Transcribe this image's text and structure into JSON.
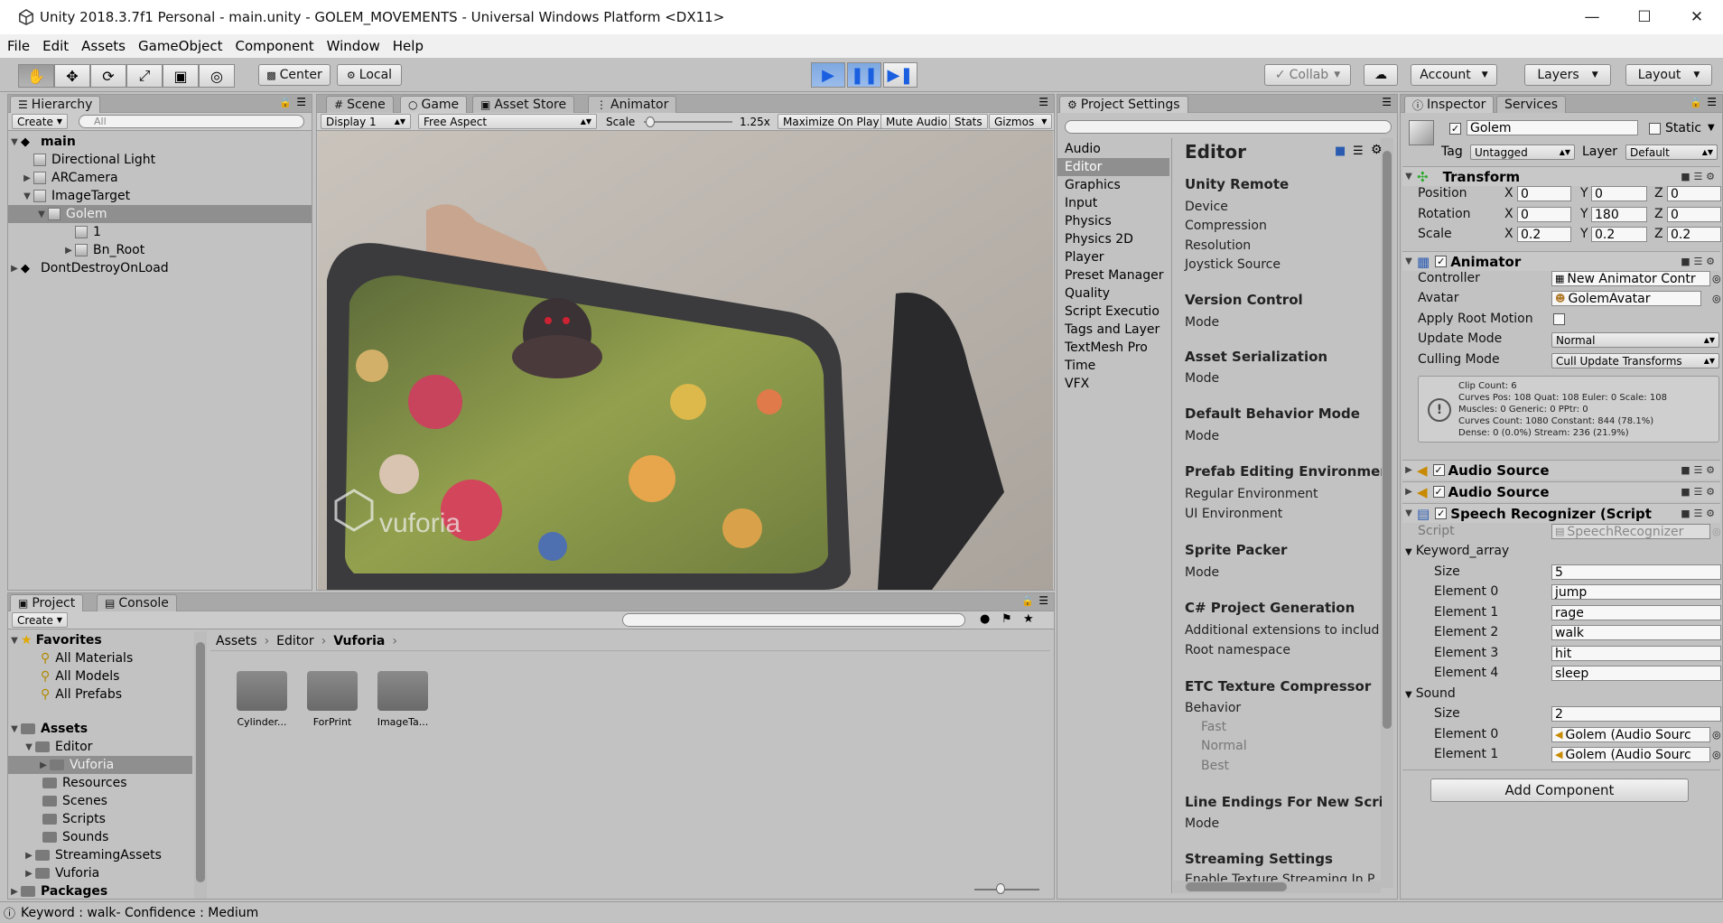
{
  "window": {
    "title": "Unity 2018.3.7f1 Personal - main.unity - GOLEM_MOVEMENTS - Universal Windows Platform <DX11>"
  },
  "menu": [
    "File",
    "Edit",
    "Assets",
    "GameObject",
    "Component",
    "Window",
    "Help"
  ],
  "toolbar": {
    "center": "Center",
    "local": "Local",
    "collab": "Collab",
    "account": "Account",
    "layers": "Layers",
    "layout": "Layout"
  },
  "hierarchy": {
    "tab": "Hierarchy",
    "create": "Create",
    "search_placeholder": "All",
    "items": [
      "main",
      "Directional Light",
      "ARCamera",
      "ImageTarget",
      "Golem",
      "1",
      "Bn_Root",
      "DontDestroyOnLoad"
    ]
  },
  "game": {
    "tabs": [
      "Scene",
      "Game",
      "Asset Store",
      "Animator"
    ],
    "display": "Display 1",
    "aspect": "Free Aspect",
    "scale_label": "Scale",
    "scale_value": "1.25x",
    "buttons": [
      "Maximize On Play",
      "Mute Audio",
      "Stats",
      "Gizmos"
    ],
    "watermark": "vuforia"
  },
  "project": {
    "tabs": [
      "Project",
      "Console"
    ],
    "create": "Create",
    "favorites": "Favorites",
    "fav_items": [
      "All Materials",
      "All Models",
      "All Prefabs"
    ],
    "assets": "Assets",
    "tree": [
      "Editor",
      "Vuforia",
      "Resources",
      "Scenes",
      "Scripts",
      "Sounds",
      "StreamingAssets",
      "Vuforia",
      "Packages"
    ],
    "breadcrumb": [
      "Assets",
      "Editor",
      "Vuforia"
    ],
    "folders": [
      "Cylinder...",
      "ForPrint",
      "ImageTa..."
    ]
  },
  "settings": {
    "tab": "Project Settings",
    "list": [
      "Audio",
      "Editor",
      "Graphics",
      "Input",
      "Physics",
      "Physics 2D",
      "Player",
      "Preset Manager",
      "Quality",
      "Script Executio",
      "Tags and Layer",
      "TextMesh Pro",
      "Time",
      "VFX"
    ],
    "title": "Editor",
    "sections": [
      {
        "h": "Unity Remote",
        "items": [
          "Device",
          "Compression",
          "Resolution",
          "Joystick Source"
        ]
      },
      {
        "h": "Version Control",
        "items": [
          "Mode"
        ]
      },
      {
        "h": "Asset Serialization",
        "items": [
          "Mode"
        ]
      },
      {
        "h": "Default Behavior Mode",
        "items": [
          "Mode"
        ]
      },
      {
        "h": "Prefab Editing Environments",
        "items": [
          "Regular Environment",
          "UI Environment"
        ]
      },
      {
        "h": "Sprite Packer",
        "items": [
          "Mode"
        ]
      },
      {
        "h": "C# Project Generation",
        "items": [
          "Additional extensions to includ",
          "Root namespace"
        ]
      },
      {
        "h": "ETC Texture Compressor",
        "items": [
          "Behavior",
          "Fast",
          "Normal",
          "Best"
        ]
      },
      {
        "h": "Line Endings For New Script",
        "items": [
          "Mode"
        ]
      },
      {
        "h": "Streaming Settings",
        "items": [
          "Enable Texture Streaming In P"
        ]
      }
    ]
  },
  "inspector": {
    "tabs": [
      "Inspector",
      "Services"
    ],
    "object_name": "Golem",
    "static_label": "Static",
    "tag_label": "Tag",
    "tag": "Untagged",
    "layer_label": "Layer",
    "layer": "Default",
    "transform": "Transform",
    "position_label": "Position",
    "position": [
      "0",
      "0",
      "0"
    ],
    "rotation_label": "Rotation",
    "rotation": [
      "0",
      "180",
      "0"
    ],
    "scale_label": "Scale",
    "scale": [
      "0.2",
      "0.2",
      "0.2"
    ],
    "animator": "Animator",
    "controller_label": "Controller",
    "controller": "New Animator Contr",
    "avatar_label": "Avatar",
    "avatar": "GolemAvatar",
    "apply_root": "Apply Root Motion",
    "update_label": "Update Mode",
    "update": "Normal",
    "culling_label": "Culling Mode",
    "culling": "Cull Update Transforms",
    "info": [
      "Clip Count: 6",
      "Curves Pos: 108 Quat: 108 Euler: 0 Scale: 108",
      "Muscles: 0 Generic: 0 PPtr: 0",
      "Curves Count: 1080 Constant: 844 (78.1%)",
      "Dense: 0 (0.0%) Stream: 236 (21.9%)"
    ],
    "audio1": "Audio Source",
    "audio2": "Audio Source",
    "speech": "Speech Recognizer (Script",
    "script_label": "Script",
    "script": "SpeechRecognizer",
    "keyword_label": "Keyword_array",
    "size_label": "Size",
    "keyword_size": "5",
    "keywords": [
      {
        "l": "Element 0",
        "v": "jump"
      },
      {
        "l": "Element 1",
        "v": "rage"
      },
      {
        "l": "Element 2",
        "v": "walk"
      },
      {
        "l": "Element 3",
        "v": "hit"
      },
      {
        "l": "Element 4",
        "v": "sleep"
      }
    ],
    "sound_label": "Sound",
    "sound_size": "2",
    "sounds": [
      {
        "l": "Element 0",
        "v": "Golem (Audio Sourc"
      },
      {
        "l": "Element 1",
        "v": "Golem (Audio Sourc"
      }
    ],
    "add_component": "Add Component"
  },
  "status": "Keyword : walk- Confidence : Medium"
}
